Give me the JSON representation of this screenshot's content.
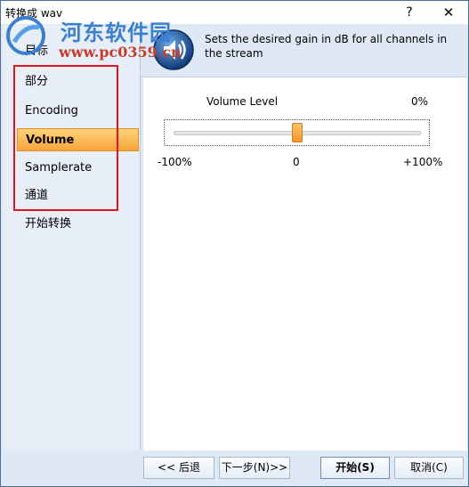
{
  "window": {
    "title": "转换成 wav",
    "help_label": "?",
    "close_label": "✕"
  },
  "watermark": {
    "site_name": "河东软件园",
    "url": "www.pc0359.cn"
  },
  "sidebar": {
    "items": [
      {
        "label": "目标"
      },
      {
        "label": "部分"
      },
      {
        "label": "Encoding"
      },
      {
        "label": "Volume"
      },
      {
        "label": "Samplerate"
      },
      {
        "label": "通道"
      },
      {
        "label": "开始转换"
      }
    ],
    "active_index": 3
  },
  "header": {
    "description": "Sets the desired gain in dB for all channels in the stream",
    "icon": "speaker-icon"
  },
  "volume": {
    "label": "Volume Level",
    "value_text": "0%",
    "value_fraction": 0.5,
    "tick_min": "-100%",
    "tick_mid": "0",
    "tick_max": "+100%"
  },
  "footer": {
    "back_label": "<< 后退",
    "next_label": "下一步(N)>>",
    "start_label": "开始(S)",
    "cancel_label": "取消(C)"
  },
  "colors": {
    "accent": "#f9a43c",
    "highlight_box": "#e2121e",
    "panel": "#dfe9f5"
  }
}
